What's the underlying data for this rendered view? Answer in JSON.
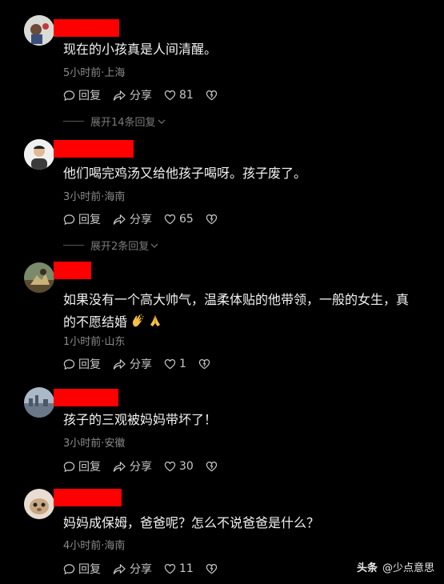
{
  "comments": [
    {
      "text": "现在的小孩真是人间清醒。",
      "meta": "5小时前·上海",
      "reply_label": "回复",
      "share_label": "分享",
      "likes": "81",
      "expand_label": "展开14条回复"
    },
    {
      "text": "他们喝完鸡汤又给他孩子喝呀。孩子废了。",
      "meta": "3小时前·海南",
      "reply_label": "回复",
      "share_label": "分享",
      "likes": "65",
      "expand_label": "展开2条回复"
    },
    {
      "text_line1": "如果没有一个高大帅气，温柔体贴的他带领，一般的女生，真",
      "text_line2": "的不愿结婚",
      "meta": "1小时前·山东",
      "reply_label": "回复",
      "share_label": "分享",
      "likes": "1"
    },
    {
      "text": "孩子的三观被妈妈带坏了！",
      "meta": "3小时前·安徽",
      "reply_label": "回复",
      "share_label": "分享",
      "likes": "30"
    },
    {
      "text": "妈妈成保姆，爸爸呢？怎么不说爸爸是什么？",
      "meta": "4小时前·海南",
      "reply_label": "回复",
      "share_label": "分享",
      "likes": "11"
    }
  ],
  "watermark": {
    "brand": "头条",
    "account": "@少点意思"
  },
  "colors": {
    "background": "#000000",
    "redaction": "#ff0000",
    "meta": "#8a8a8a"
  }
}
